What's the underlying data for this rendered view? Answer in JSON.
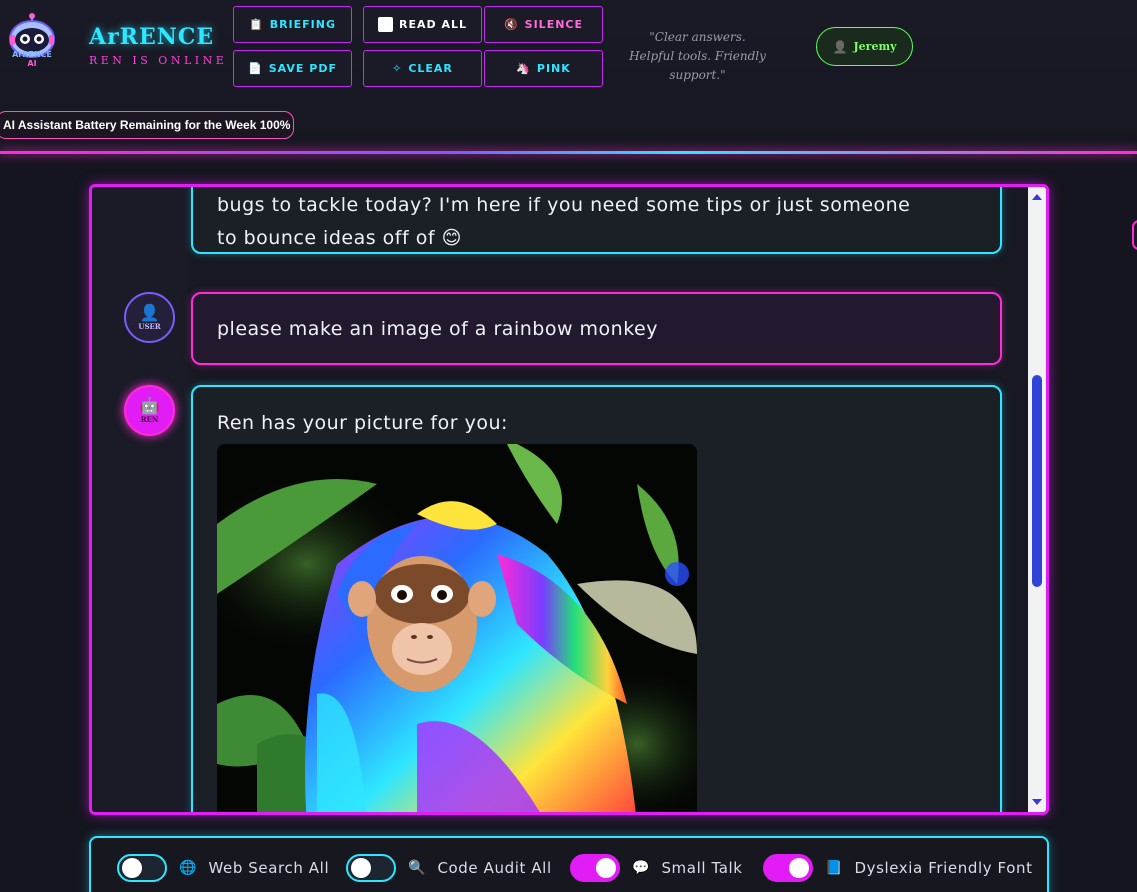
{
  "brand": {
    "logo_text": "ArRENCE",
    "logo_sub": "AI",
    "title": "ArRENCE",
    "subtitle": "REN IS ONLINE"
  },
  "toolbar": {
    "briefing": {
      "icon": "📋",
      "label": "BRIEFING"
    },
    "read_all": {
      "label": "READ ALL"
    },
    "silence": {
      "icon": "🔇",
      "label": "SILENCE"
    },
    "save_pdf": {
      "icon": "📄",
      "label": "SAVE PDF"
    },
    "clear": {
      "icon": "✧",
      "label": "CLEAR"
    },
    "pink": {
      "icon": "🦄",
      "label": "PINK"
    }
  },
  "quote": {
    "line1": "\"Clear answers.",
    "line2": "Helpful tools. Friendly support.\""
  },
  "user": {
    "name": "Jeremy",
    "icon": "👤"
  },
  "battery": {
    "label": "AI Assistant Battery Remaining for the Week 100%",
    "percent": 100
  },
  "messages": [
    {
      "role": "ai",
      "line1": "bugs to tackle today? I'm here if you need some tips or just someone",
      "line2": "to bounce ideas off of 😊"
    },
    {
      "role": "user",
      "avatar_label": "USER",
      "text": "please make an image of a rainbow monkey"
    },
    {
      "role": "ai",
      "avatar_label": "REN",
      "text": "Ren has your picture for you:"
    }
  ],
  "footer": {
    "toggles": [
      {
        "icon": "🌐",
        "label": "Web Search All",
        "on": false
      },
      {
        "icon": "🔍",
        "label": "Code Audit All",
        "on": false
      },
      {
        "icon": "💬",
        "label": "Small Talk",
        "on": true
      },
      {
        "icon": "📘",
        "label": "Dyslexia Friendly Font",
        "on": true
      }
    ]
  },
  "colors": {
    "accent_cyan": "#2ee6ff",
    "accent_magenta": "#e21cf5",
    "accent_pink": "#ff2bd6",
    "user_green": "#5cff5c",
    "background": "#15151f"
  }
}
